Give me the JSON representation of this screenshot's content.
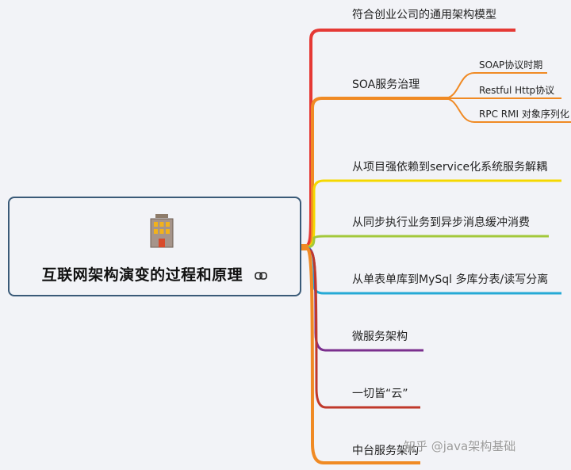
{
  "root": {
    "title": "互联网架构演变的过程和原理"
  },
  "branches": [
    {
      "label": "符合创业公司的通用架构模型",
      "color": "#e53935"
    },
    {
      "label": "SOA服务治理",
      "color": "#f08a24",
      "children": [
        {
          "label": "SOAP协议时期"
        },
        {
          "label": "Restful Http协议"
        },
        {
          "label": "RPC RMI 对象序列化"
        }
      ]
    },
    {
      "label": "从项目强依赖到service化系统服务解耦",
      "color": "#f5d800"
    },
    {
      "label": "从同步执行业务到异步消息缓冲消费",
      "color": "#a3c83a"
    },
    {
      "label": "从单表单库到MySql 多库分表/读写分离",
      "color": "#25a9d6"
    },
    {
      "label": "微服务架构",
      "color": "#7b2f8e"
    },
    {
      "label": "一切皆“云”",
      "color": "#c0392b"
    },
    {
      "label": "中台服务架构",
      "color": "#f08a24"
    }
  ],
  "watermark": "知乎 @java架构基础"
}
